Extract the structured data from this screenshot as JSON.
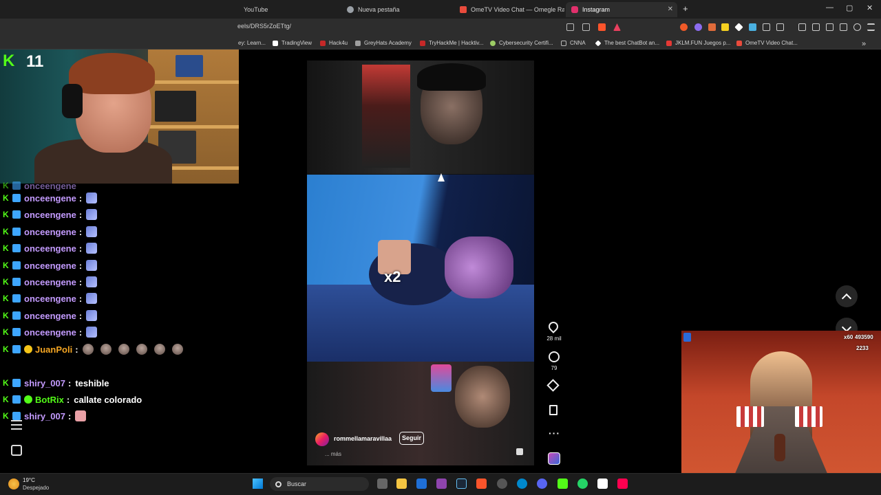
{
  "browser": {
    "tabs": [
      {
        "label": "YouTube",
        "color": "#ff0000"
      },
      {
        "label": "Nueva pestaña",
        "color": "#9aa0a6"
      },
      {
        "label": "OmeTV Video Chat — Omegle Rand",
        "color": "#e94b3c"
      },
      {
        "label": "Instagram",
        "color": "#e1306c",
        "active": true
      }
    ],
    "new_tab": "+",
    "window_controls": [
      "—",
      "▢",
      "✕"
    ],
    "url": "eels/DRS5rZoETtg/",
    "bookmarks": [
      {
        "label": "ey: Learn...",
        "color": "#888888"
      },
      {
        "label": "TradingView",
        "color": "#ffffff"
      },
      {
        "label": "Hack4u",
        "color": "#c62828"
      },
      {
        "label": "GreyHats Academy",
        "color": "#9e9e9e"
      },
      {
        "label": "TryHackMe | Hacktiv...",
        "color": "#c62828"
      },
      {
        "label": "Cybersecurity Certifi...",
        "color": "#9ccc65"
      },
      {
        "label": "CNNA",
        "color": "#bbbbbb"
      },
      {
        "label": "The best ChatBot an...",
        "color": "#ffffff"
      },
      {
        "label": "JKLM.FUN Juegos p...",
        "color": "#e53935"
      },
      {
        "label": "OmeTV Video Chat...",
        "color": "#e94b3c"
      }
    ],
    "bookmarks_overflow": "»"
  },
  "stream": {
    "logo": "K",
    "viewer_count": "11"
  },
  "chat": {
    "messages": [
      {
        "user": "onceengene",
        "color": "#c49bff",
        "emote": "blue"
      },
      {
        "user": "onceengene",
        "color": "#c49bff",
        "emote": "blue"
      },
      {
        "user": "onceengene",
        "color": "#c49bff",
        "emote": "blue"
      },
      {
        "user": "onceengene",
        "color": "#c49bff",
        "emote": "blue"
      },
      {
        "user": "onceengene",
        "color": "#c49bff",
        "emote": "blue"
      },
      {
        "user": "onceengene",
        "color": "#c49bff",
        "emote": "blue"
      },
      {
        "user": "onceengene",
        "color": "#c49bff",
        "emote": "blue"
      },
      {
        "user": "onceengene",
        "color": "#c49bff",
        "emote": "blue"
      },
      {
        "user": "onceengene",
        "color": "#c49bff",
        "emote": "blue"
      },
      {
        "user": "onceengene",
        "color": "#c49bff",
        "emote": "blue"
      },
      {
        "user": "JuanPoli",
        "color": "#f5a623",
        "emote": "faces"
      },
      {
        "user": "shiry_007",
        "color": "#c49bff",
        "text": "teshible"
      },
      {
        "user": "BotRix",
        "color": "#53fc18",
        "text": "callate colorado"
      },
      {
        "user": "shiry_007",
        "color": "#c49bff",
        "emote": "pink"
      }
    ],
    "separator": ":"
  },
  "reel": {
    "sticker_text": "x2",
    "username": "rommellamaravillaa",
    "follow_label": "Seguir",
    "caption_more": "... más",
    "likes": "28 mil",
    "comments": "79",
    "more": "···"
  },
  "game": {
    "multiplier": "x60",
    "score": "493590",
    "coins": "2233"
  },
  "taskbar": {
    "temperature": "19°C",
    "weather": "Despejado",
    "search_placeholder": "Buscar",
    "apps": [
      "#f4c542",
      "#8e44ad",
      "#1b2838",
      "#fb542b",
      "#555555",
      "#0088cc",
      "#5865f2",
      "#53fc18",
      "#25d366",
      "#ffffff",
      "#ff0050"
    ]
  }
}
